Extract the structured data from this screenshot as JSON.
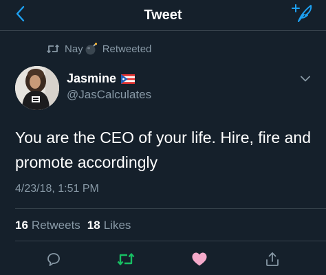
{
  "header": {
    "title": "Tweet",
    "back_icon": "chevron-left-icon",
    "compose_icon": "compose-tweet-icon"
  },
  "retweet_context": {
    "icon": "retweet-icon",
    "user": "Nay",
    "emoji": "bomb-icon",
    "label": "Retweeted"
  },
  "tweet": {
    "author_name": "Jasmine",
    "author_flag": "puerto-rico-flag-icon",
    "author_handle": "@JasCalculates",
    "text": "You are the CEO of your life. Hire, fire and promote accordingly",
    "timestamp": "4/23/18, 1:51 PM"
  },
  "stats": {
    "retweets_count": "16",
    "retweets_label": "Retweets",
    "likes_count": "18",
    "likes_label": "Likes"
  },
  "actions": {
    "reply_icon": "reply-icon",
    "retweet_icon": "retweet-icon",
    "like_icon": "heart-icon",
    "share_icon": "share-icon"
  },
  "colors": {
    "background": "#15202b",
    "accent": "#1da1f2",
    "retweeted_green": "#17bf63",
    "liked_pink": "#f4aaca",
    "muted": "#8899a6",
    "divider": "#38444d"
  }
}
